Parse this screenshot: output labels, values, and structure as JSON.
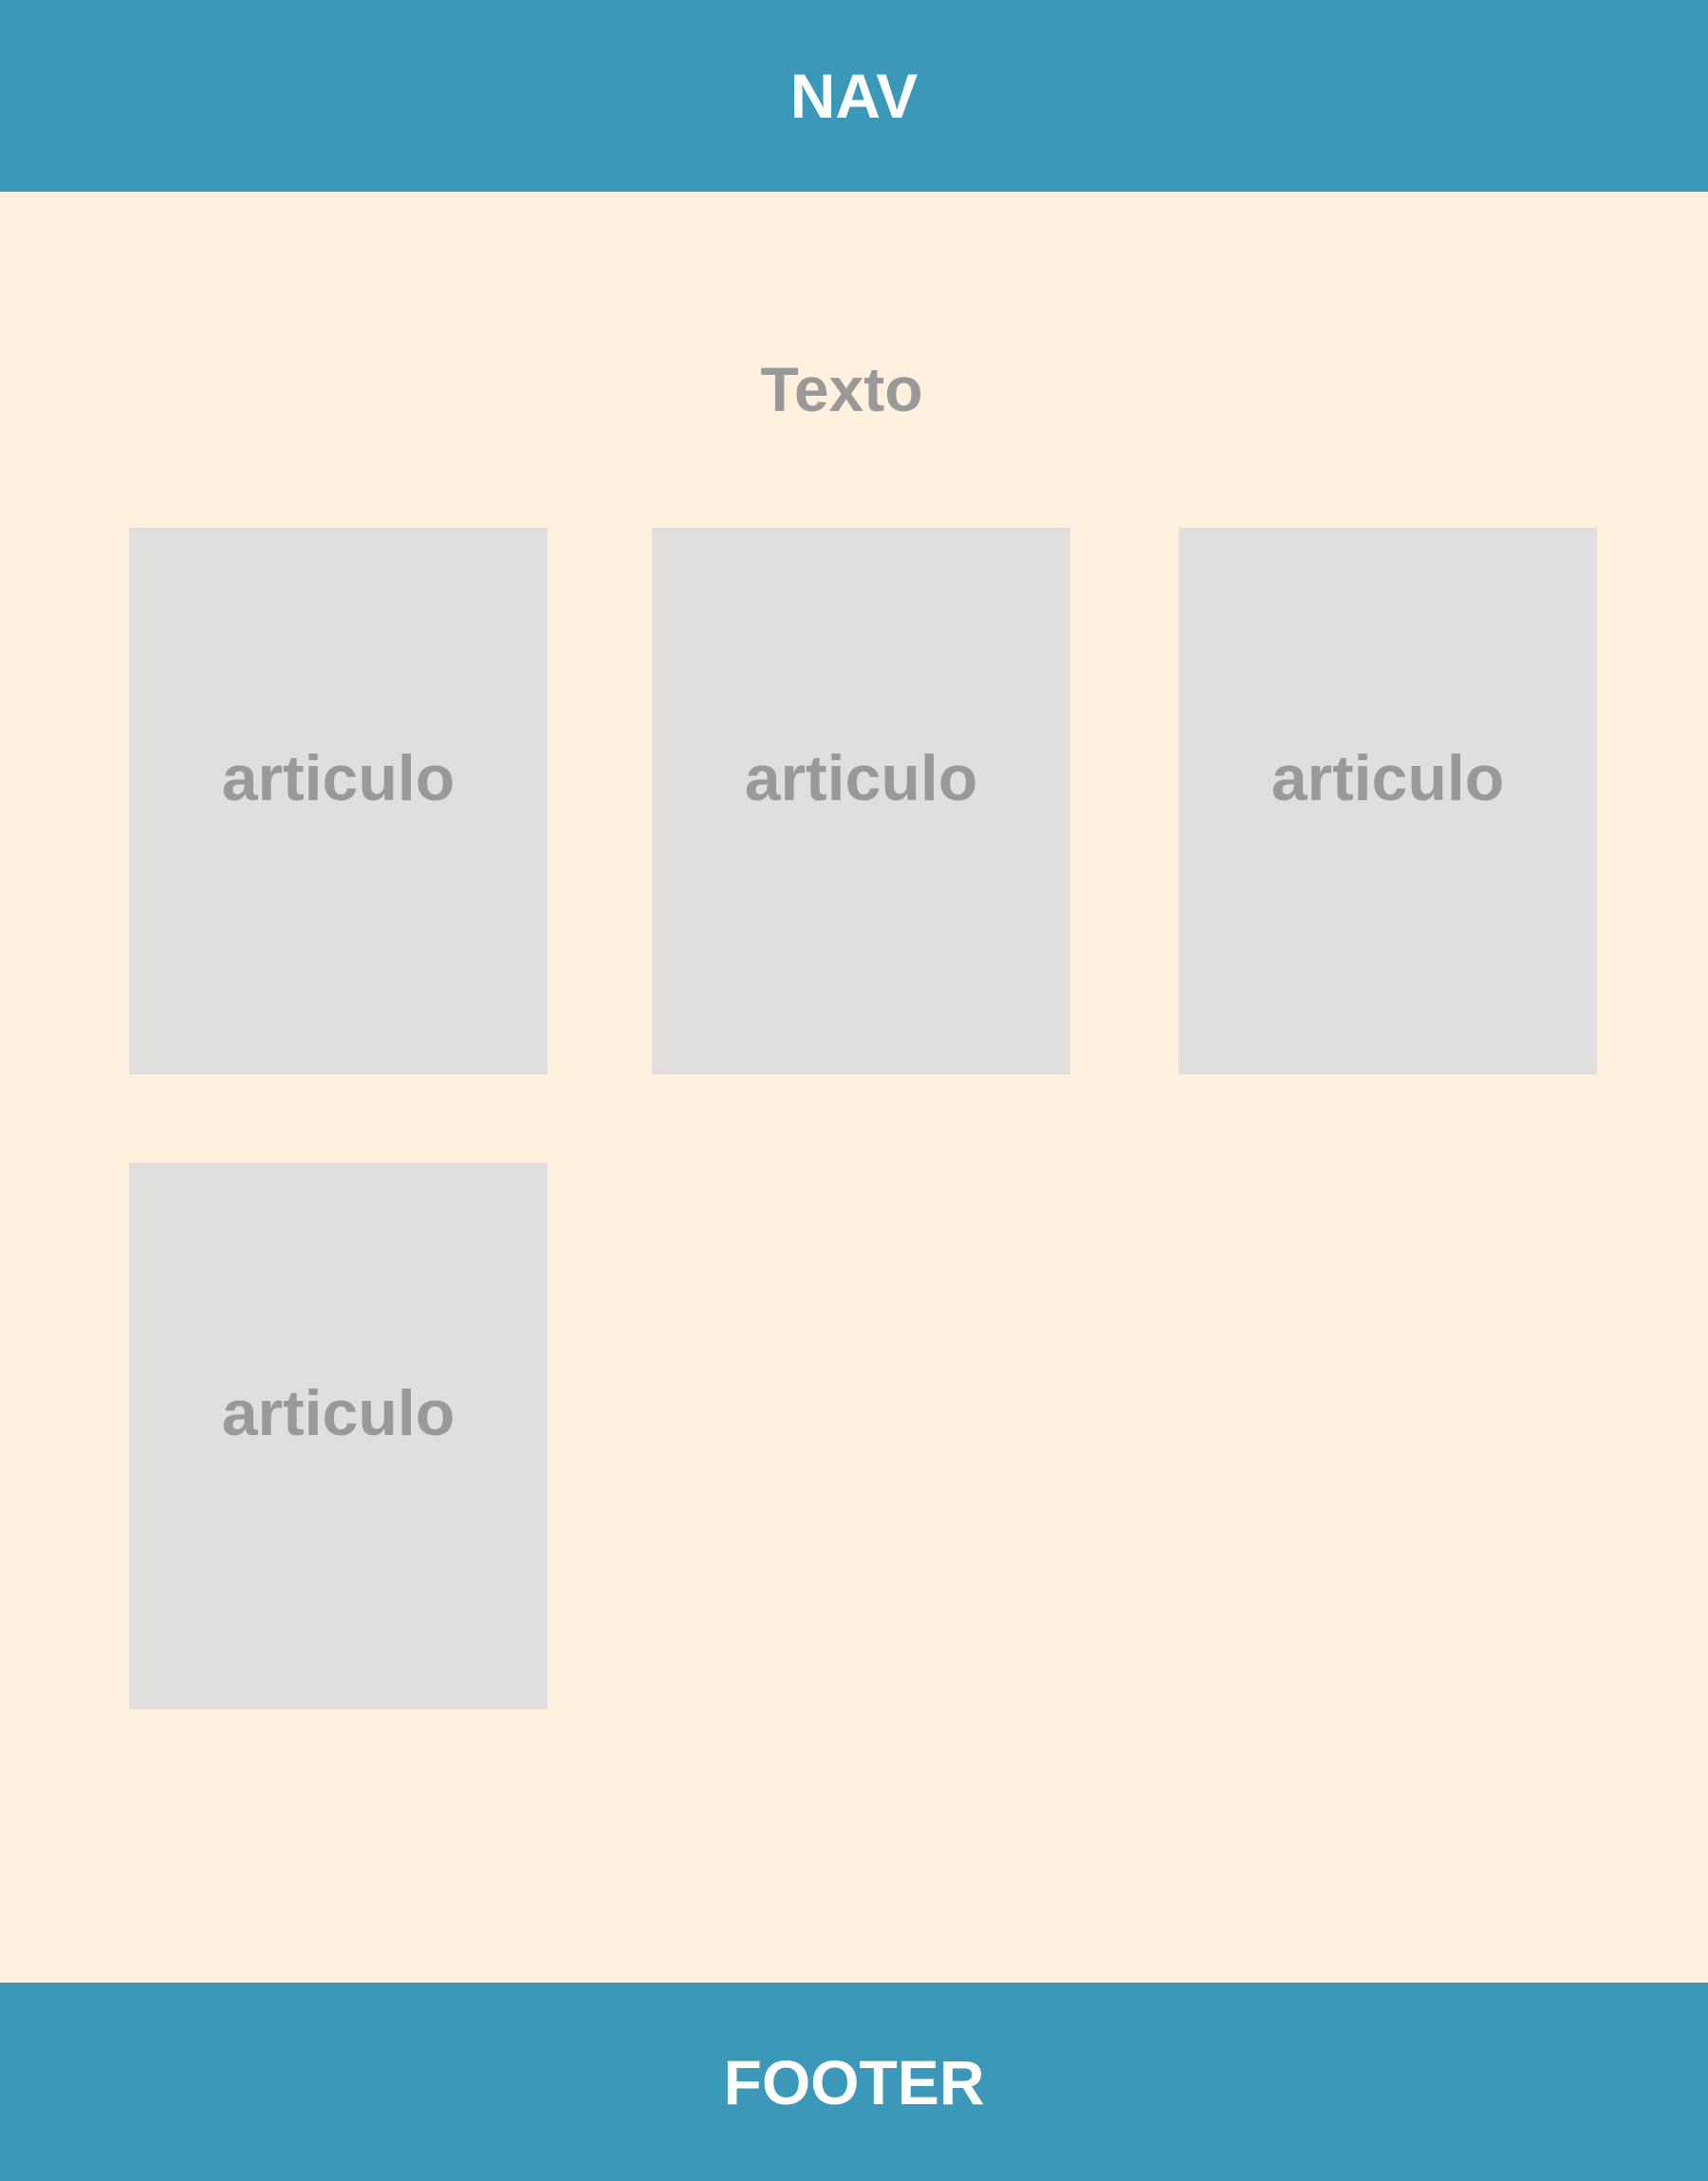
{
  "nav": {
    "label": "NAV"
  },
  "main": {
    "title": "Texto",
    "articles": [
      {
        "label": "articulo"
      },
      {
        "label": "articulo"
      },
      {
        "label": "articulo"
      },
      {
        "label": "articulo"
      }
    ]
  },
  "footer": {
    "label": "FOOTER"
  },
  "colors": {
    "bar": "#3b98b9",
    "background": "#fff1de",
    "card": "#e0dfdd",
    "muted_text": "#999999"
  }
}
